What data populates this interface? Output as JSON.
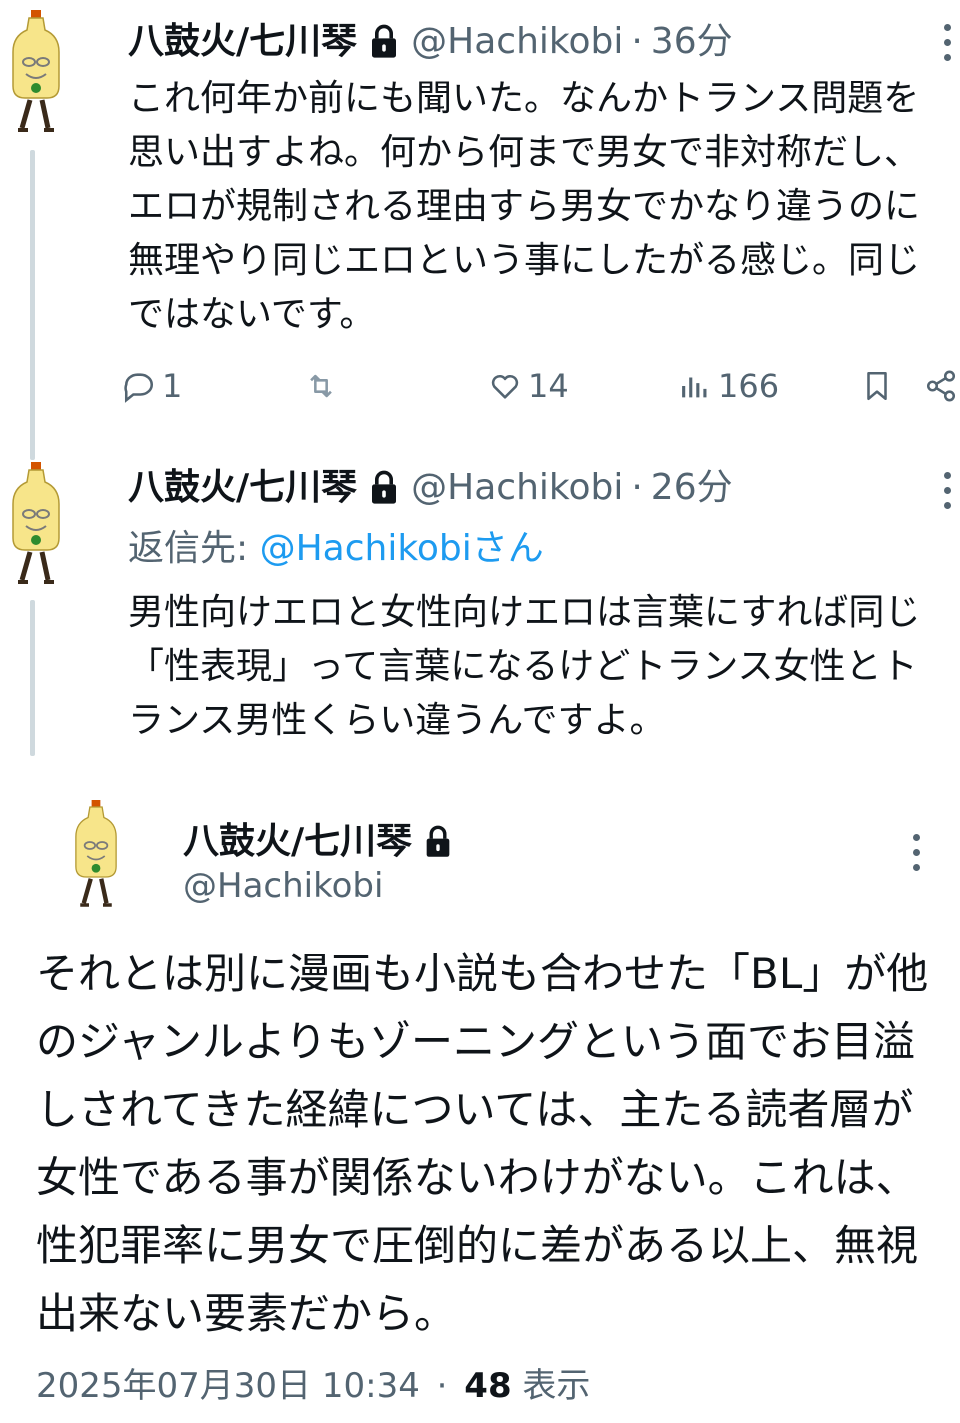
{
  "tweets": [
    {
      "name": "八鼓火/七川琴",
      "handle": "@Hachikobi",
      "dot": "·",
      "time": "36分",
      "text": "これ何年か前にも聞いた。なんかトランス問題を思い出すよね。何から何まで男女で非対称だし、エロが規制される理由すら男女でかなり違うのに無理やり同じエロという事にしたがる感じ。同じではないです。",
      "replies": "1",
      "retweets": "",
      "likes": "14",
      "views": "166"
    },
    {
      "name": "八鼓火/七川琴",
      "handle": "@Hachikobi",
      "dot": "·",
      "time": "26分",
      "reply_label": "返信先: ",
      "reply_mention": "@Hachikobiさん",
      "text": "男性向けエロと女性向けエロは言葉にすれば同じ「性表現」って言葉になるけどトランス女性とトランス男性くらい違うんですよ。"
    }
  ],
  "main": {
    "name": "八鼓火/七川琴",
    "handle": "@Hachikobi",
    "text": "それとは別に漫画も小説も合わせた「BL」が他のジャンルよりもゾーニングという面でお目溢しされてきた経緯については、主たる読者層が女性である事が関係ないわけがない。これは、性犯罪率に男女で圧倒的に差がある以上、無視出来ない要素だから。",
    "date": "2025年07月30日 10:34",
    "dot": "·",
    "views_count": "48",
    "views_label": " 表示"
  },
  "icons": [
    "lock-icon",
    "more-icon",
    "reply-icon",
    "retweet-icon",
    "like-icon",
    "views-icon",
    "bookmark-icon",
    "share-icon"
  ],
  "colors": {
    "text": "#0f1419",
    "secondary": "#536471",
    "link": "#1d9bf0",
    "thread_line": "#cfd9de"
  }
}
